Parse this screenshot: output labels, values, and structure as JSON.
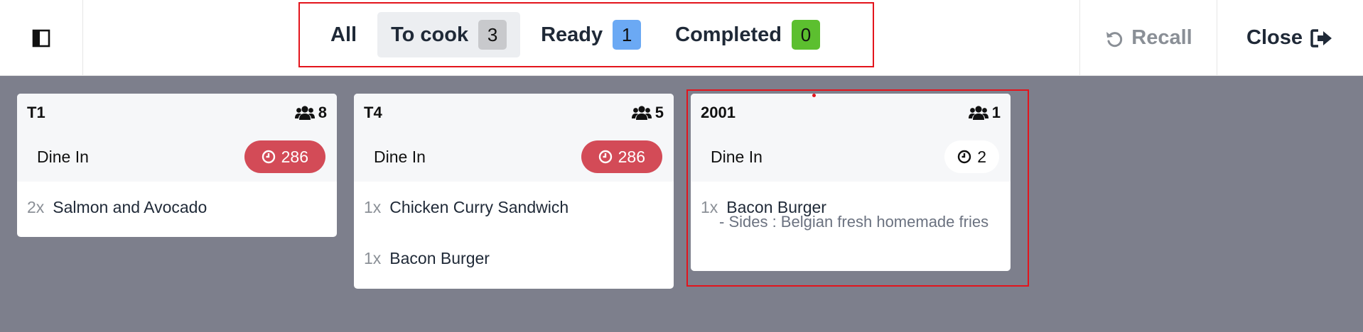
{
  "toolbar": {
    "tabs": [
      {
        "label": "All",
        "count": null
      },
      {
        "label": "To cook",
        "count": "3"
      },
      {
        "label": "Ready",
        "count": "1"
      },
      {
        "label": "Completed",
        "count": "0"
      }
    ],
    "recall_label": "Recall",
    "close_label": "Close",
    "colors": {
      "to_cook_badge": "#c8c9cc",
      "ready_badge": "#6ba9f4",
      "completed_badge": "#5cbf2f",
      "highlight": "#e3141c"
    }
  },
  "orders": [
    {
      "table": "T1",
      "guests": "8",
      "type": "Dine In",
      "timer": "286",
      "timer_status": "late",
      "lines": [
        {
          "qty": "2x",
          "name": "Salmon and Avocado",
          "note": ""
        }
      ]
    },
    {
      "table": "T4",
      "guests": "5",
      "type": "Dine In",
      "timer": "286",
      "timer_status": "late",
      "lines": [
        {
          "qty": "1x",
          "name": "Chicken Curry Sandwich",
          "note": ""
        },
        {
          "qty": "1x",
          "name": "Bacon Burger",
          "note": ""
        }
      ]
    },
    {
      "table": "2001",
      "guests": "1",
      "type": "Dine In",
      "timer": "2",
      "timer_status": "ok",
      "lines": [
        {
          "qty": "1x",
          "name": "Bacon Burger",
          "note": "- Sides : Belgian fresh homemade fries"
        }
      ]
    }
  ],
  "icons": {
    "sidebar_toggle": "sidebar-toggle-icon",
    "recall": "undo-icon",
    "close": "sign-out-icon",
    "guests": "users-icon",
    "timer": "clock-icon"
  }
}
